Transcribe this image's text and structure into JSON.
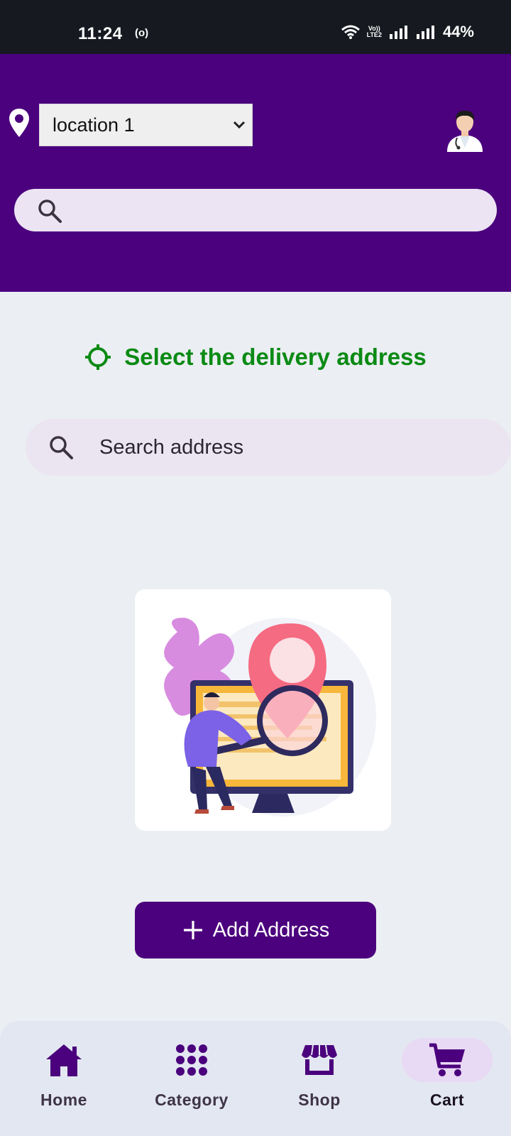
{
  "status_bar": {
    "time": "11:24",
    "record_indicator": "(o)",
    "volte_top": "Vo))",
    "volte_bottom": "LTE2",
    "battery": "44%",
    "icons": [
      "wifi-icon",
      "signal-icon",
      "signal-icon"
    ]
  },
  "header": {
    "background": "#4b007d",
    "location_select": {
      "value": "location 1",
      "options": [
        "location 1"
      ]
    },
    "search": {
      "placeholder": ""
    },
    "icons": [
      "location-pin-icon",
      "chevron-down-icon",
      "doctor-avatar",
      "search-icon"
    ]
  },
  "main": {
    "title": "Select the delivery address",
    "title_color": "#0a8a14",
    "address_search": {
      "placeholder": "Search address"
    },
    "illustration": "location-search-illustration",
    "add_address_button": {
      "label": "Add Address",
      "icon": "plus-icon"
    }
  },
  "bottom_nav": {
    "items": [
      {
        "label": "Home",
        "icon": "home-icon",
        "active": false
      },
      {
        "label": "Category",
        "icon": "grid-icon",
        "active": false
      },
      {
        "label": "Shop",
        "icon": "store-icon",
        "active": false
      },
      {
        "label": "Cart",
        "icon": "cart-icon",
        "active": true
      }
    ],
    "accent": "#4b007d"
  }
}
